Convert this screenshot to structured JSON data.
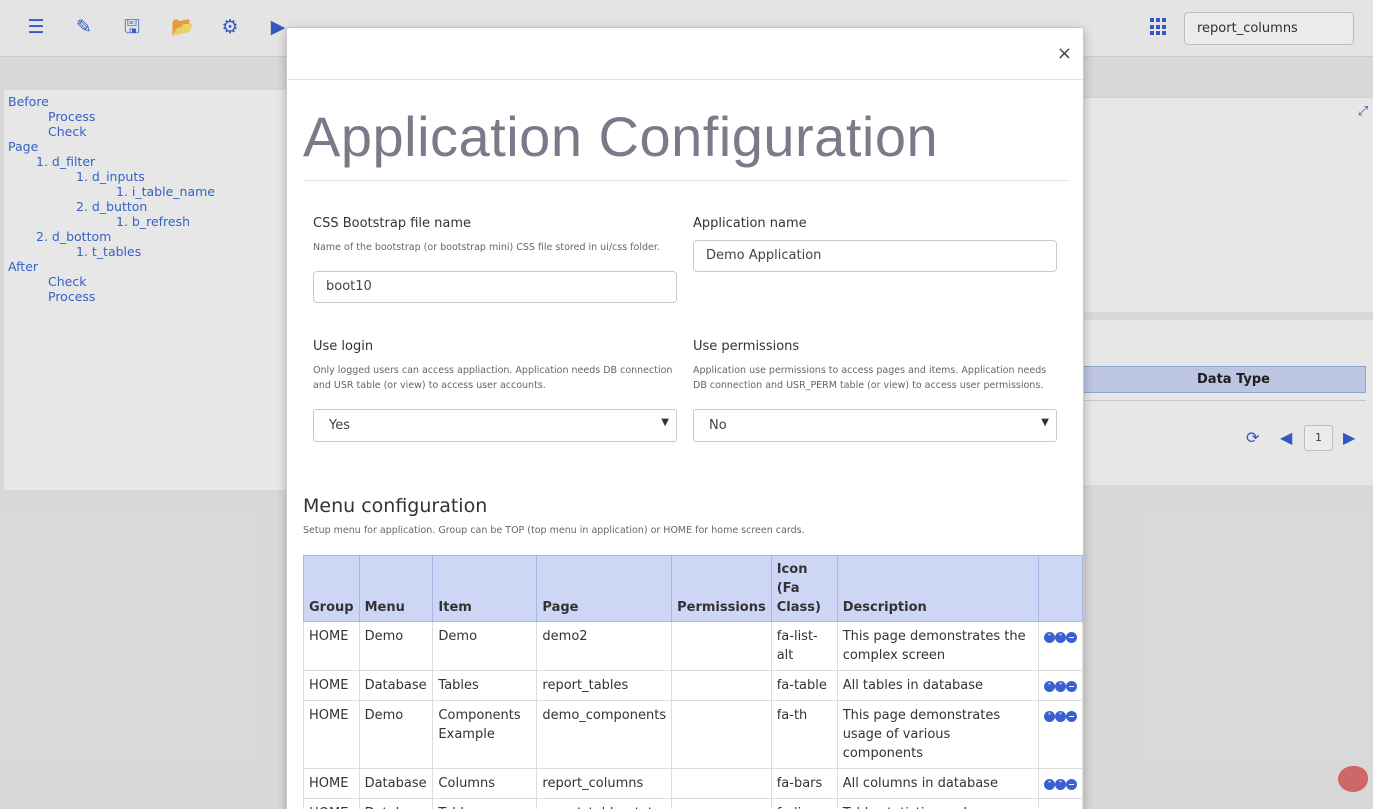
{
  "toolbar": {
    "icons": [
      "menu-icon",
      "edit-icon",
      "save-icon",
      "folder-open-icon",
      "gear-icon",
      "play-icon",
      "flask-icon",
      "magic-icon",
      "undo-icon"
    ],
    "search_value": "report_columns",
    "accent": "#3a5fd0"
  },
  "tree": [
    {
      "text": "Before"
    },
    {
      "text": "Process"
    },
    {
      "text": "Check"
    },
    {
      "text": "Page"
    },
    {
      "text": "1. d_filter"
    },
    {
      "text": "1. d_inputs"
    },
    {
      "text": "1. i_table_name"
    },
    {
      "text": "2. d_button"
    },
    {
      "text": "1. b_refresh"
    },
    {
      "text": "2. d_bottom"
    },
    {
      "text": "1. t_tables"
    },
    {
      "text": "After"
    },
    {
      "text": "Check"
    },
    {
      "text": "Process"
    }
  ],
  "right_table": {
    "header": "Data Type",
    "page_number": "1"
  },
  "modal": {
    "close_label": "×",
    "title": "Application Configuration",
    "fields": {
      "css_label": "CSS Bootstrap file name",
      "css_help": "Name of the bootstrap (or bootstrap mini) CSS file stored in ui/css folder.",
      "css_value": "boot10",
      "appname_label": "Application name",
      "appname_value": "Demo Application",
      "login_label": "Use login",
      "login_help": "Only logged users can access appliaction. Application needs DB connection and USR table (or view) to access user accounts.",
      "login_value": "Yes",
      "perm_label": "Use permissions",
      "perm_help": "Application use permissions to access pages and items. Application needs DB connection and USR_PERM table (or view) to access user permissions.",
      "perm_value": "No"
    },
    "menu": {
      "title": "Menu configuration",
      "help": "Setup menu for application. Group can be TOP (top menu in application) or HOME for home screen cards.",
      "columns": [
        "Group",
        "Menu",
        "Item",
        "Page",
        "Permissions",
        "Icon (Fa Class)",
        "Description",
        ""
      ],
      "rows": [
        {
          "group": "HOME",
          "menu": "Demo",
          "item": "Demo",
          "page": "demo2",
          "permissions": "",
          "icon": "fa-list-alt",
          "description": "This page demonstrates the complex screen"
        },
        {
          "group": "HOME",
          "menu": "Database",
          "item": "Tables",
          "page": "report_tables",
          "permissions": "",
          "icon": "fa-table",
          "description": "All tables in database"
        },
        {
          "group": "HOME",
          "menu": "Demo",
          "item": "Components Example",
          "page": "demo_components",
          "permissions": "",
          "icon": "fa-th",
          "description": "This page demonstrates usage of various components"
        },
        {
          "group": "HOME",
          "menu": "Database",
          "item": "Columns",
          "page": "report_columns",
          "permissions": "",
          "icon": "fa-bars",
          "description": "All columns in database"
        },
        {
          "group": "HOME",
          "menu": "Database",
          "item": "Table Statistics",
          "page": "report_table_stat",
          "permissions": "",
          "icon": "fa-line-chart",
          "description": "Table statistics and histograms"
        }
      ]
    }
  }
}
